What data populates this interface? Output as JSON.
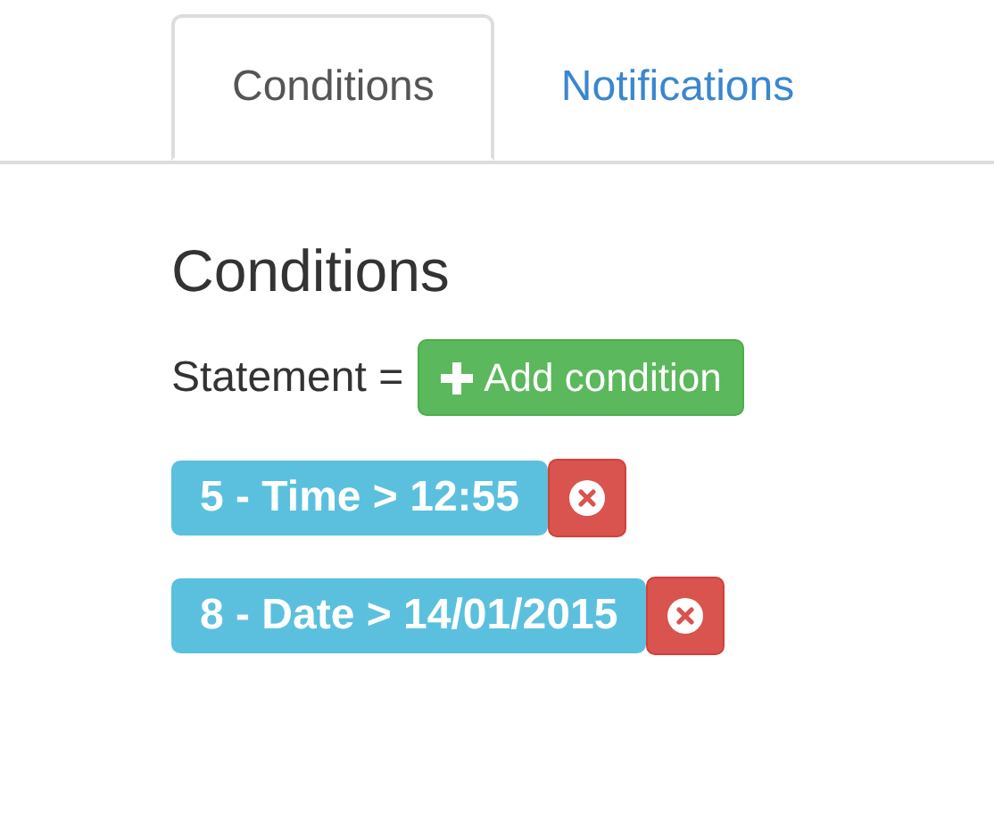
{
  "tabs": [
    {
      "label": "Conditions",
      "selected": true
    },
    {
      "label": "Notifications",
      "selected": false
    }
  ],
  "heading": "Conditions",
  "statement_label": "Statement =",
  "add_button": {
    "label": "Add condition"
  },
  "conditions": [
    {
      "label": "5 - Time > 12:55"
    },
    {
      "label": "8 - Date > 14/01/2015"
    }
  ]
}
